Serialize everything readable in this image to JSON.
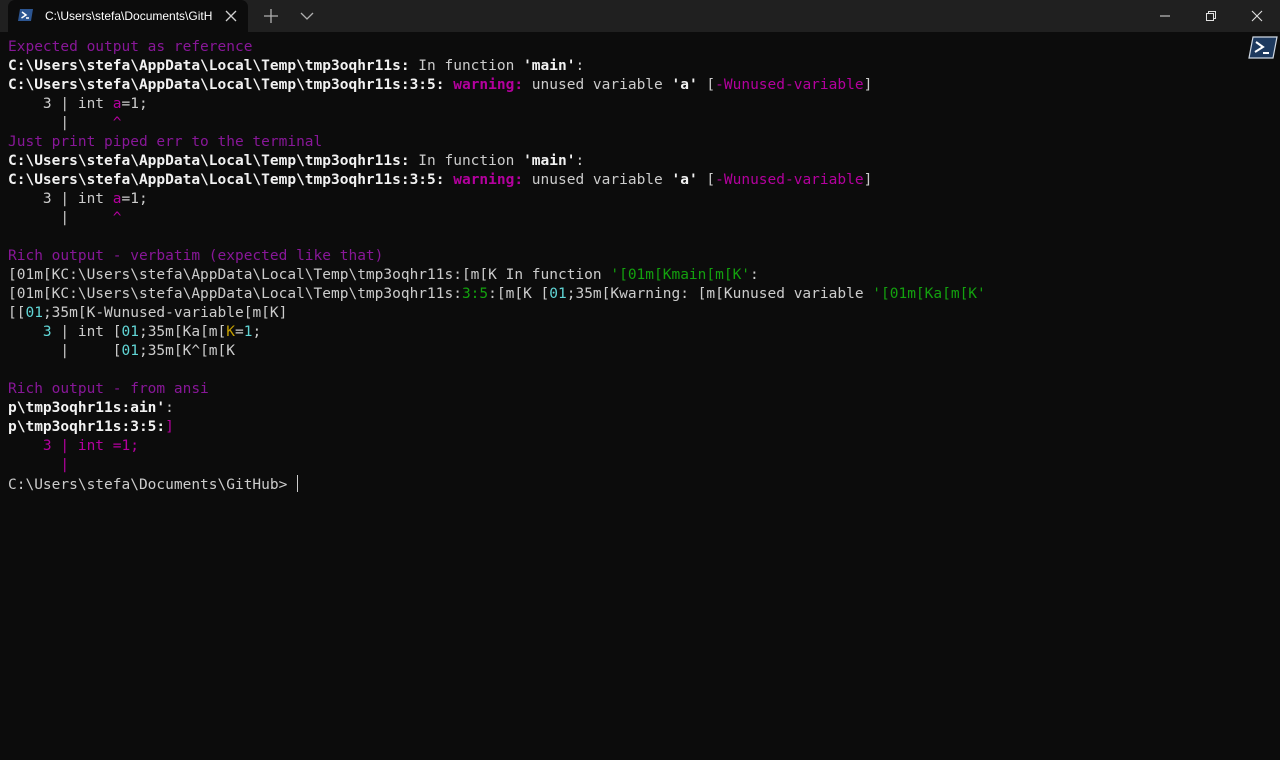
{
  "tab": {
    "title": "C:\\Users\\stefa\\Documents\\GitH",
    "icon": "powershell-icon"
  },
  "colors": {
    "background": "#0c0c0c",
    "titlebar": "#202020",
    "magenta": "#881798",
    "magenta_bright": "#b4009e",
    "green": "#13a10e",
    "cyan": "#61d6d6"
  },
  "terminal": {
    "lines": [
      [
        {
          "t": "Expected output as reference",
          "c": "c-mag"
        }
      ],
      [
        {
          "t": "C:\\Users\\stefa\\AppData\\Local\\Temp\\tmp3oqhr11s:",
          "c": "c-white"
        },
        {
          "t": " In function ",
          "c": "c-grey"
        },
        {
          "t": "'main'",
          "c": "c-white"
        },
        {
          "t": ":",
          "c": "c-grey"
        }
      ],
      [
        {
          "t": "C:\\Users\\stefa\\AppData\\Local\\Temp\\tmp3oqhr11s:3:5:",
          "c": "c-white"
        },
        {
          "t": " warning:",
          "c": "c-magb b"
        },
        {
          "t": " unused variable ",
          "c": "c-grey"
        },
        {
          "t": "'a'",
          "c": "c-white"
        },
        {
          "t": " [",
          "c": "c-grey"
        },
        {
          "t": "-Wunused-variable",
          "c": "c-magb"
        },
        {
          "t": "]",
          "c": "c-grey"
        }
      ],
      [
        {
          "t": "    3 | int ",
          "c": "c-grey"
        },
        {
          "t": "a",
          "c": "c-magb"
        },
        {
          "t": "=1;",
          "c": "c-grey"
        }
      ],
      [
        {
          "t": "      |     ",
          "c": "c-grey"
        },
        {
          "t": "^",
          "c": "c-magb"
        }
      ],
      [
        {
          "t": "Just print piped err to the terminal",
          "c": "c-mag"
        }
      ],
      [
        {
          "t": "C:\\Users\\stefa\\AppData\\Local\\Temp\\tmp3oqhr11s:",
          "c": "c-white"
        },
        {
          "t": " In function ",
          "c": "c-grey"
        },
        {
          "t": "'main'",
          "c": "c-white"
        },
        {
          "t": ":",
          "c": "c-grey"
        }
      ],
      [
        {
          "t": "C:\\Users\\stefa\\AppData\\Local\\Temp\\tmp3oqhr11s:3:5:",
          "c": "c-white"
        },
        {
          "t": " warning:",
          "c": "c-magb b"
        },
        {
          "t": " unused variable ",
          "c": "c-grey"
        },
        {
          "t": "'a'",
          "c": "c-white"
        },
        {
          "t": " [",
          "c": "c-grey"
        },
        {
          "t": "-Wunused-variable",
          "c": "c-magb"
        },
        {
          "t": "]",
          "c": "c-grey"
        }
      ],
      [
        {
          "t": "    3 | int ",
          "c": "c-grey"
        },
        {
          "t": "a",
          "c": "c-magb"
        },
        {
          "t": "=1;",
          "c": "c-grey"
        }
      ],
      [
        {
          "t": "      |     ",
          "c": "c-grey"
        },
        {
          "t": "^",
          "c": "c-magb"
        }
      ],
      [
        {
          "t": "",
          "c": "c-grey"
        }
      ],
      [
        {
          "t": "Rich output - verbatim (expected like that)",
          "c": "c-mag"
        }
      ],
      [
        {
          "t": "[01m[KC:\\Users\\stefa\\AppData\\Local\\Temp\\tmp3oqhr11s:[m[K In function ",
          "c": "c-grey"
        },
        {
          "t": "'[01m[Kmain[m[K'",
          "c": "c-green"
        },
        {
          "t": ":",
          "c": "c-grey"
        }
      ],
      [
        {
          "t": "[01m[KC:\\Users\\stefa\\AppData\\Local\\Temp\\tmp3oqhr11s:",
          "c": "c-grey"
        },
        {
          "t": "3:5",
          "c": "c-green"
        },
        {
          "t": ":[m[K [",
          "c": "c-grey"
        },
        {
          "t": "01",
          "c": "c-cyanb"
        },
        {
          "t": ";35m[Kwarning: [m[Kunused variable ",
          "c": "c-grey"
        },
        {
          "t": "'[01m[Ka[m[K'",
          "c": "c-green"
        }
      ],
      [
        {
          "t": "[[",
          "c": "c-grey"
        },
        {
          "t": "01",
          "c": "c-cyanb"
        },
        {
          "t": ";35m[K-Wunused-variable[m[K]",
          "c": "c-grey"
        }
      ],
      [
        {
          "t": "    ",
          "c": "c-grey"
        },
        {
          "t": "3",
          "c": "c-cyanb"
        },
        {
          "t": " | int [",
          "c": "c-grey"
        },
        {
          "t": "01",
          "c": "c-cyanb"
        },
        {
          "t": ";35m[Ka[m[",
          "c": "c-grey"
        },
        {
          "t": "K",
          "c": "c-yellow"
        },
        {
          "t": "=",
          "c": "c-grey"
        },
        {
          "t": "1",
          "c": "c-cyanb"
        },
        {
          "t": ";",
          "c": "c-grey"
        }
      ],
      [
        {
          "t": "      |     [",
          "c": "c-grey"
        },
        {
          "t": "01",
          "c": "c-cyanb"
        },
        {
          "t": ";35m[K^[m[K",
          "c": "c-grey"
        }
      ],
      [
        {
          "t": "",
          "c": "c-grey"
        }
      ],
      [
        {
          "t": "Rich output - from ansi",
          "c": "c-mag"
        }
      ],
      [
        {
          "t": "p\\tmp3oqhr11s:ain'",
          "c": "c-white"
        },
        {
          "t": ":",
          "c": "c-grey"
        }
      ],
      [
        {
          "t": "p\\tmp3oqhr11s:3:5:",
          "c": "c-white"
        },
        {
          "t": "]",
          "c": "c-magb"
        }
      ],
      [
        {
          "t": "    3 | int =1;",
          "c": "c-magb"
        }
      ],
      [
        {
          "t": "      |",
          "c": "c-magb"
        }
      ],
      [
        {
          "t": "C:\\Users\\stefa\\Documents\\GitHub> ",
          "c": "c-grey"
        }
      ]
    ]
  }
}
